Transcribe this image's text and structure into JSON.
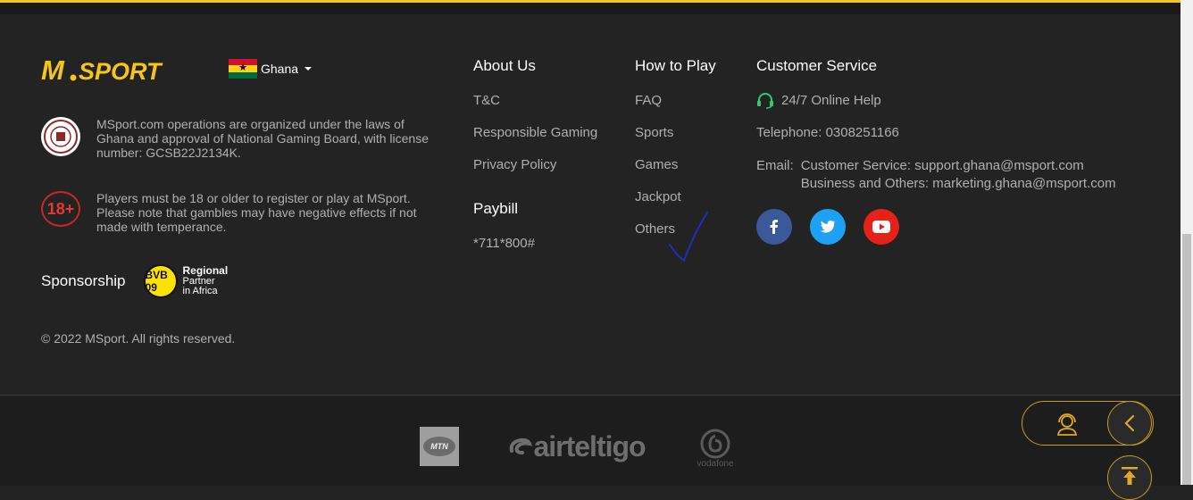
{
  "brand": {
    "logo_text": "M.SPORT",
    "color": "#f5c518"
  },
  "country": {
    "label": "Ghana",
    "flag_colors": [
      "#ce1126",
      "#fcd116",
      "#006b3f"
    ]
  },
  "about": {
    "license_text": "MSport.com operations are organized under the laws of Ghana and approval of National Gaming Board, with license number: GCSB22J2134K.",
    "age_badge": "18+",
    "age_text": "Players must be 18 or older to register or play at MSport. Please note that gambles may have negative effects if not made with temperance."
  },
  "sponsorship": {
    "label": "Sponsorship",
    "badge_text": "BVB 09",
    "partner_line1": "Regional",
    "partner_line2": "Partner",
    "partner_line3": "in Africa"
  },
  "copyright": "© 2022 MSport. All rights reserved.",
  "columns": {
    "about_us": {
      "title": "About Us",
      "links": [
        "T&C",
        "Responsible Gaming",
        "Privacy Policy"
      ]
    },
    "paybill": {
      "title": "Paybill",
      "code": "*711*800#"
    },
    "how_to_play": {
      "title": "How to Play",
      "links": [
        "FAQ",
        "Sports",
        "Games",
        "Jackpot",
        "Others"
      ]
    },
    "customer_service": {
      "title": "Customer Service",
      "online_help": "24/7 Online Help",
      "telephone": "Telephone: 0308251166",
      "email_label": "Email:",
      "email_cs": "Customer Service: support.ghana@msport.com",
      "email_biz": "Business and Others: marketing.ghana@msport.com"
    }
  },
  "socials": [
    {
      "name": "facebook",
      "glyph": "f",
      "color": "#3b5998"
    },
    {
      "name": "twitter",
      "glyph": "t",
      "color": "#1da1f2"
    },
    {
      "name": "youtube",
      "glyph": "▶",
      "color": "#e62117"
    }
  ],
  "payments": {
    "mtn": "MTN",
    "airteltigo": "airteltigo",
    "vodafone": "vodafone"
  }
}
